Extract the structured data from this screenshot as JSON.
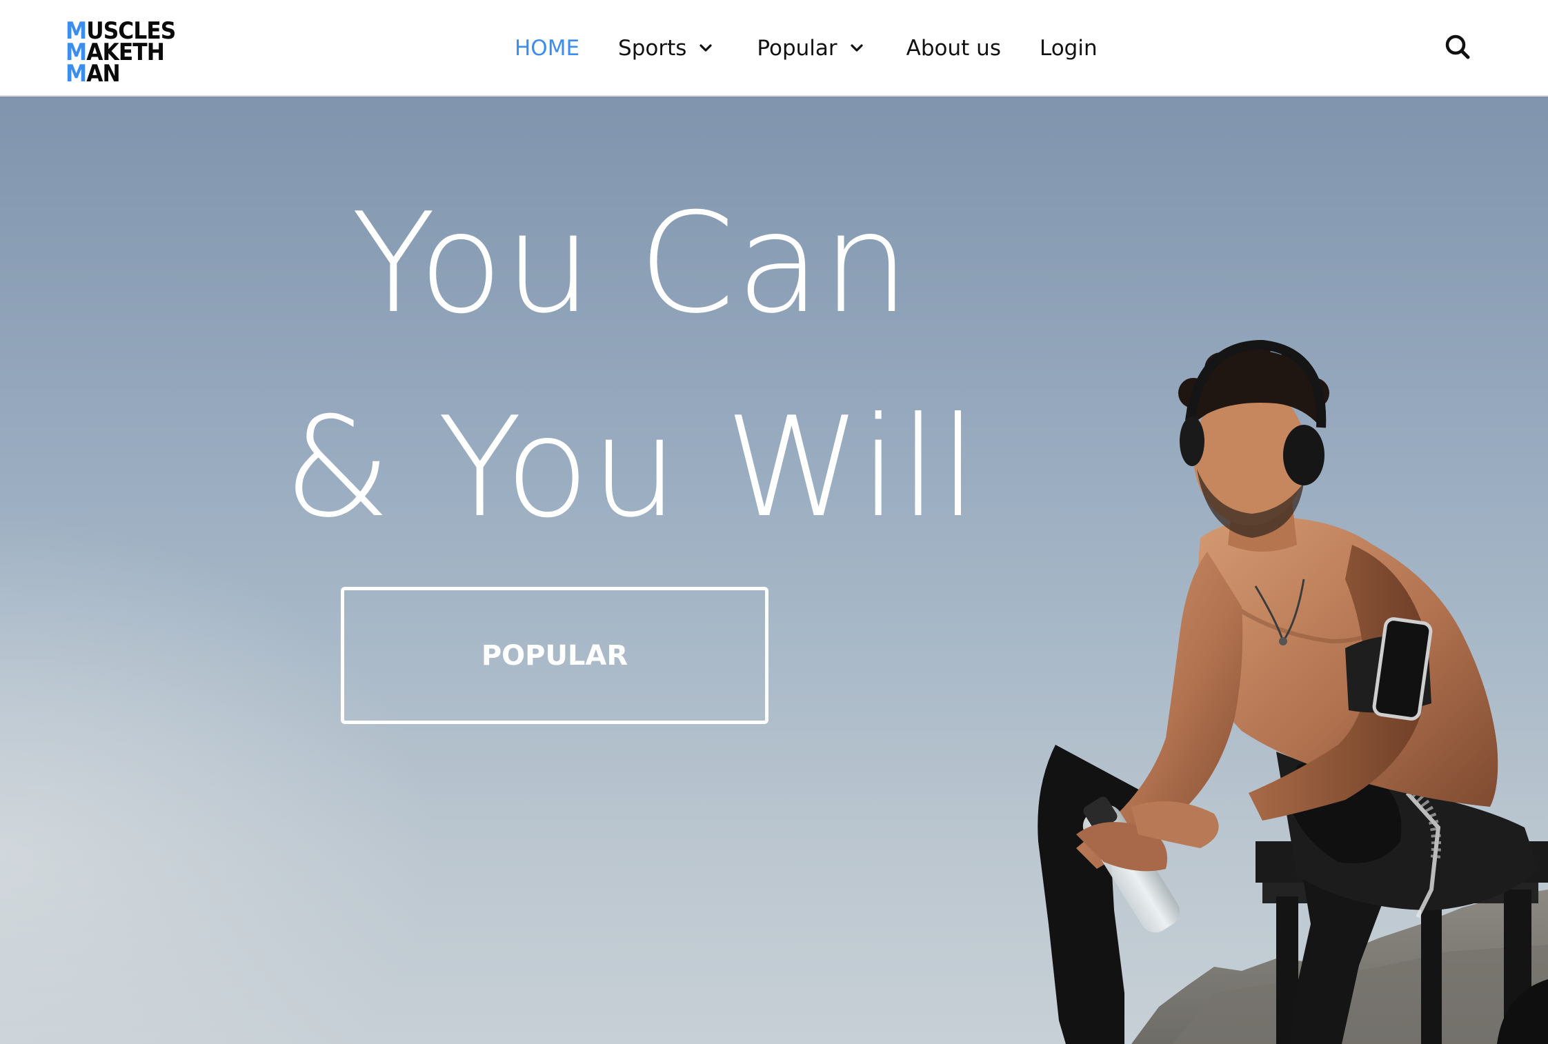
{
  "brand": {
    "logo_lines": [
      {
        "lead": "M",
        "rest": "USCLES"
      },
      {
        "lead": "M",
        "rest": "AKETH"
      },
      {
        "lead": "M",
        "rest": "AN"
      }
    ],
    "accent_color": "#3b8ef0"
  },
  "nav": {
    "items": [
      {
        "label": "HOME",
        "active": true,
        "has_dropdown": false
      },
      {
        "label": "Sports",
        "active": false,
        "has_dropdown": true
      },
      {
        "label": "Popular",
        "active": false,
        "has_dropdown": true
      },
      {
        "label": "About us",
        "active": false,
        "has_dropdown": false
      },
      {
        "label": "Login",
        "active": false,
        "has_dropdown": false
      }
    ],
    "dropdown_icon": "chevron-down-icon",
    "search_icon": "search-icon"
  },
  "hero": {
    "title_lines": [
      "You Can",
      "& You Will"
    ],
    "cta_label": "POPULAR",
    "background": "photo of athlete sitting on bench against blue sky"
  }
}
